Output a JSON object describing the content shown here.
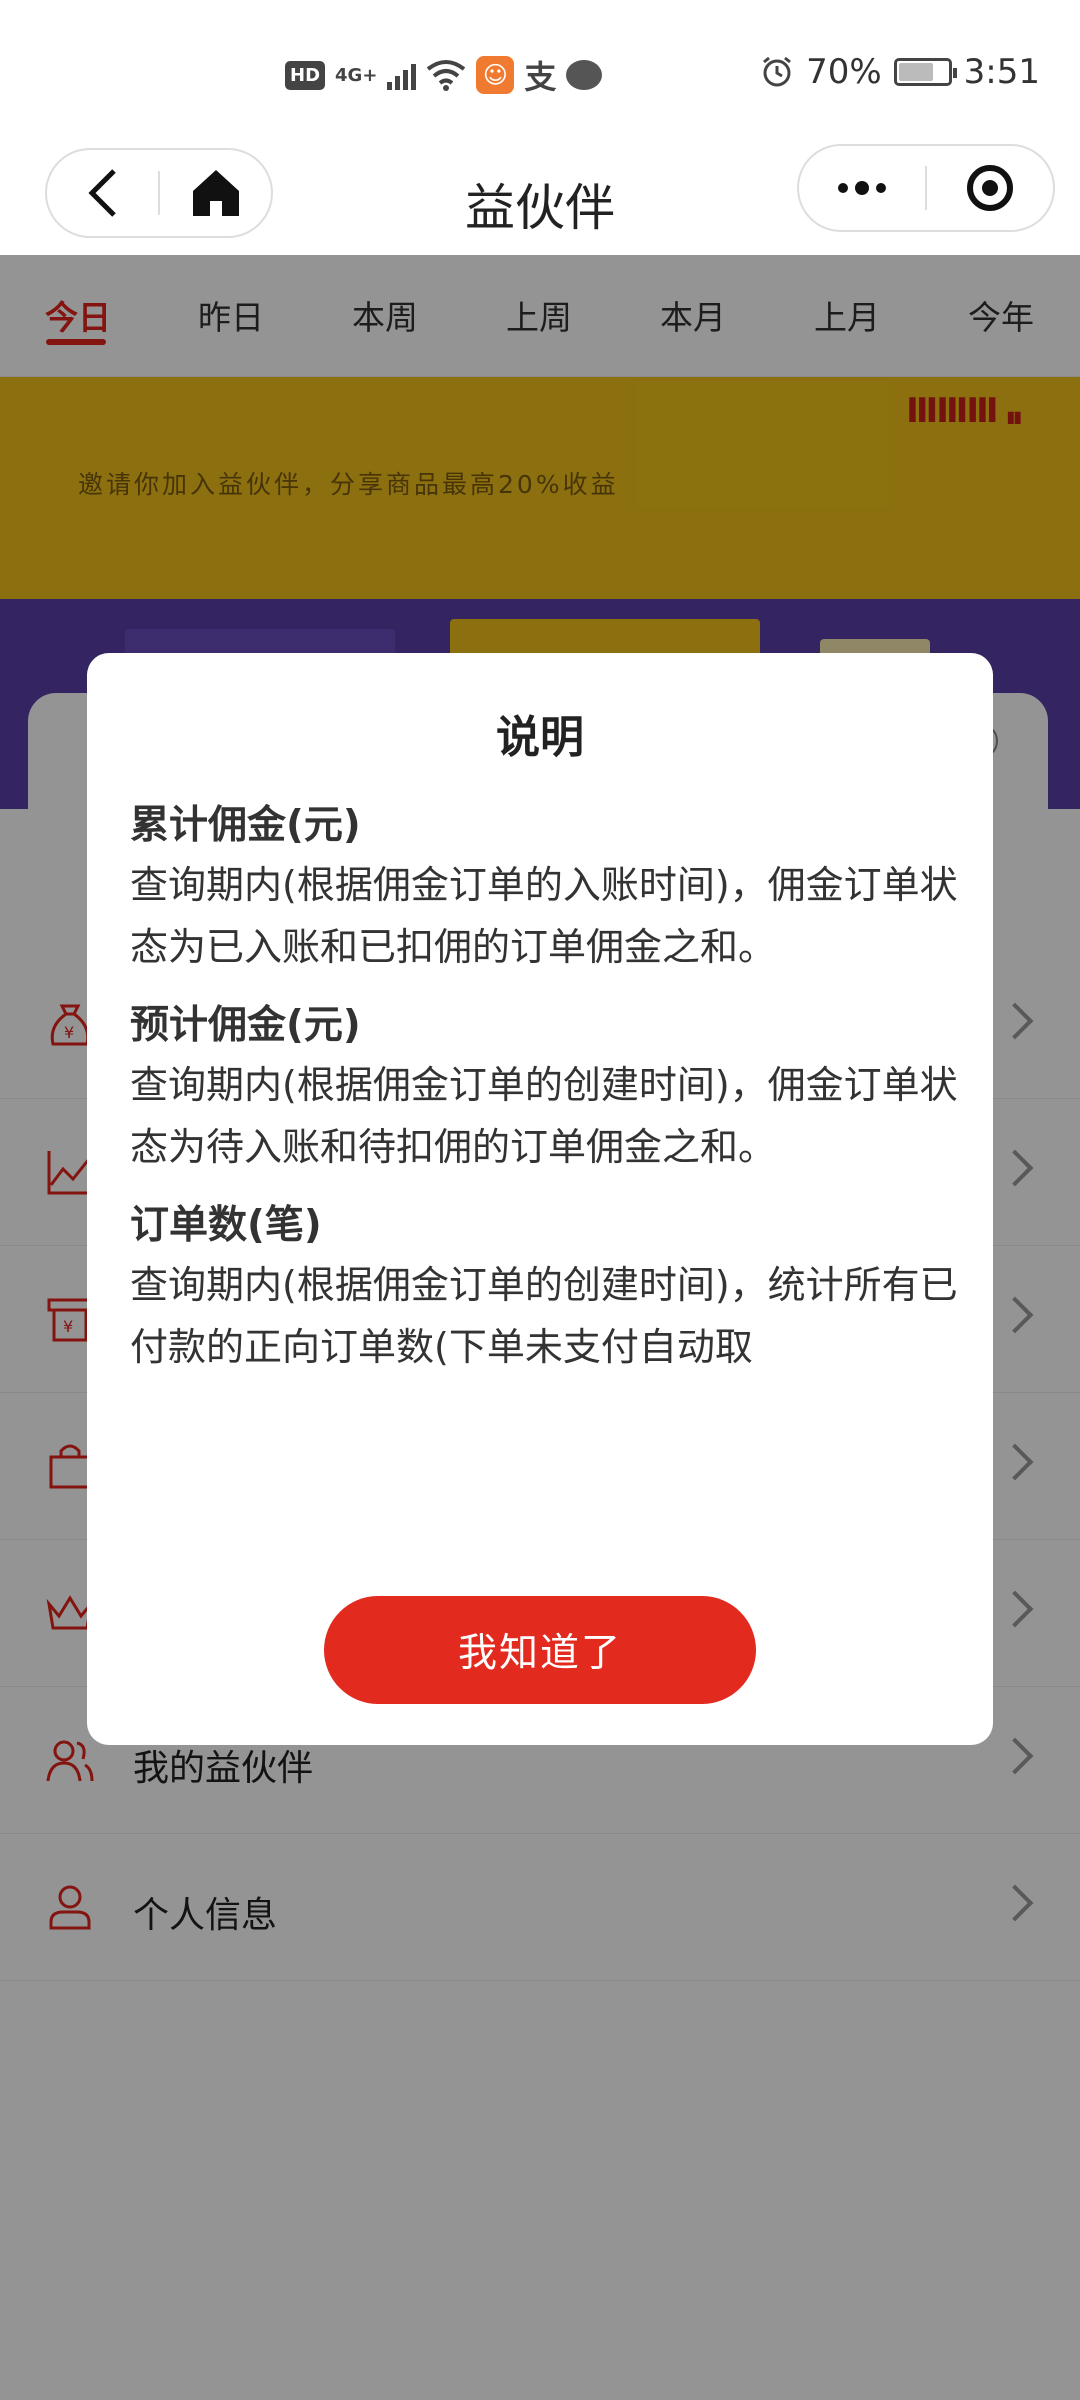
{
  "status_bar": {
    "hd": "HD",
    "network": "4G+",
    "zhifubao_glyph": "支",
    "battery_percent": "70%",
    "battery_level": 0.7,
    "time": "3:51"
  },
  "nav": {
    "title": "益伙伴",
    "back_icon": "chevron-left-icon",
    "home_icon": "home-icon",
    "more_icon": "more-dots-icon",
    "close_icon": "target-icon"
  },
  "tabs": [
    "今日",
    "昨日",
    "本周",
    "上周",
    "本月",
    "上月",
    "今年"
  ],
  "active_tab": 0,
  "banner": {
    "text": "邀请你加入益伙伴，分享商品最高20%收益"
  },
  "menu": [
    {
      "label": "",
      "icon": "money-bag-icon"
    },
    {
      "label": "",
      "icon": "chart-line-icon"
    },
    {
      "label": "",
      "icon": "cash-register-icon"
    },
    {
      "label": "",
      "icon": "shopping-bag-icon"
    },
    {
      "label": "",
      "icon": "crown-icon"
    },
    {
      "label": "我的益伙伴",
      "icon": "users-icon"
    },
    {
      "label": "个人信息",
      "icon": "user-icon"
    }
  ],
  "modal": {
    "title": "说明",
    "sections": [
      {
        "heading": "累计佣金(元)",
        "text": "查询期内(根据佣金订单的入账时间)，佣金订单状态为已入账和已扣佣的订单佣金之和。"
      },
      {
        "heading": "预计佣金(元)",
        "text": "查询期内(根据佣金订单的创建时间)，佣金订单状态为待入账和待扣佣的订单佣金之和。"
      },
      {
        "heading": "订单数(笔)",
        "text": "查询期内(根据佣金订单的创建时间)，统计所有已付款的正向订单数(下单未支付自动取"
      }
    ],
    "confirm_label": "我知道了"
  },
  "colors": {
    "accent": "#e2231a",
    "banner_yellow": "#f1c21a",
    "banner_purple": "#5a3ea8"
  }
}
